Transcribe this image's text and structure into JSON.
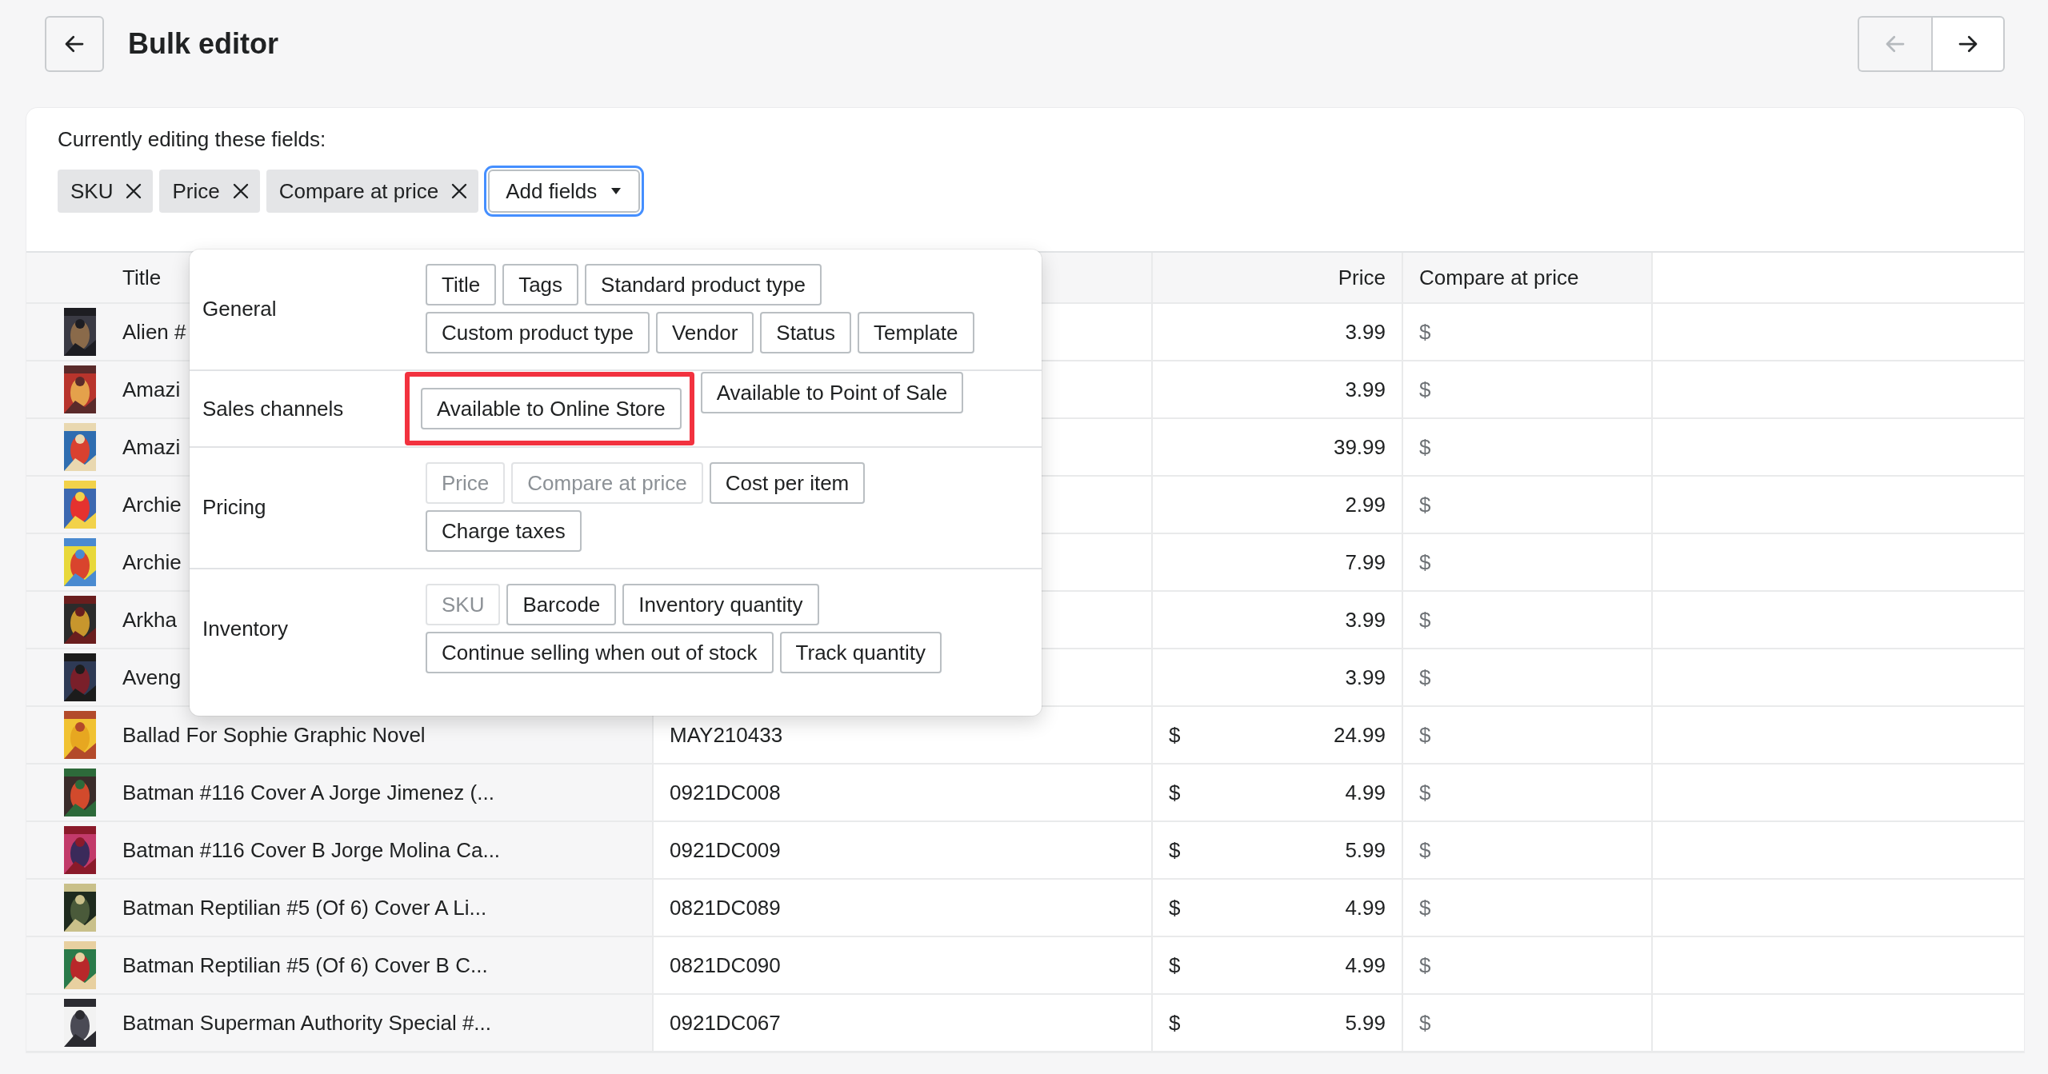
{
  "header": {
    "title": "Bulk editor",
    "nav": [
      {
        "kind": "previous",
        "disabled": true
      },
      {
        "kind": "next",
        "disabled": false
      }
    ]
  },
  "editing": {
    "label": "Currently editing these fields:",
    "fields": [
      "SKU",
      "Price",
      "Compare at price"
    ],
    "add_button": {
      "label": "Add fields",
      "focused": true
    }
  },
  "field_menu": {
    "groups": [
      {
        "name": "General",
        "options": [
          {
            "label": "Title",
            "disabled": false,
            "highlighted": false
          },
          {
            "label": "Tags",
            "disabled": false,
            "highlighted": false
          },
          {
            "label": "Standard product type",
            "disabled": false,
            "highlighted": false
          },
          {
            "label": "Custom product type",
            "disabled": false,
            "highlighted": false
          },
          {
            "label": "Vendor",
            "disabled": false,
            "highlighted": false
          },
          {
            "label": "Status",
            "disabled": false,
            "highlighted": false
          },
          {
            "label": "Template",
            "disabled": false,
            "highlighted": false
          }
        ]
      },
      {
        "name": "Sales channels",
        "options": [
          {
            "label": "Available to Online Store",
            "disabled": false,
            "highlighted": true
          },
          {
            "label": "Available to Point of Sale",
            "disabled": false,
            "highlighted": false
          }
        ]
      },
      {
        "name": "Pricing",
        "options": [
          {
            "label": "Price",
            "disabled": true,
            "highlighted": false
          },
          {
            "label": "Compare at price",
            "disabled": true,
            "highlighted": false
          },
          {
            "label": "Cost per item",
            "disabled": false,
            "highlighted": false
          },
          {
            "label": "Charge taxes",
            "disabled": false,
            "highlighted": false
          }
        ]
      },
      {
        "name": "Inventory",
        "options": [
          {
            "label": "SKU",
            "disabled": true,
            "highlighted": false
          },
          {
            "label": "Barcode",
            "disabled": false,
            "highlighted": false
          },
          {
            "label": "Inventory quantity",
            "disabled": false,
            "highlighted": false
          },
          {
            "label": "Continue selling when out of stock",
            "disabled": false,
            "highlighted": false
          },
          {
            "label": "Track quantity",
            "disabled": false,
            "highlighted": false
          }
        ]
      }
    ]
  },
  "table": {
    "columns": [
      {
        "kind": "title",
        "label": "Title"
      },
      {
        "kind": "sku"
      },
      {
        "kind": "price",
        "label": "Price"
      },
      {
        "kind": "compare",
        "label": "Compare at price"
      }
    ],
    "rows": [
      {
        "title": "Alien #",
        "price": "3.99",
        "compare_currency": "$"
      },
      {
        "title": "Amazi",
        "price": "3.99",
        "compare_currency": "$"
      },
      {
        "title": "Amazi",
        "price": "39.99",
        "compare_currency": "$"
      },
      {
        "title": "Archie",
        "price": "2.99",
        "compare_currency": "$"
      },
      {
        "title": "Archie",
        "price": "7.99",
        "compare_currency": "$"
      },
      {
        "title": "Arkha",
        "price": "3.99",
        "compare_currency": "$"
      },
      {
        "title": "Aveng",
        "price": "3.99",
        "compare_currency": "$"
      },
      {
        "title": "Ballad For Sophie Graphic Novel",
        "sku": "MAY210433",
        "currency": "$",
        "price": "24.99",
        "compare_currency": "$"
      },
      {
        "title": "Batman #116 Cover A Jorge Jimenez (...",
        "sku": "0921DC008",
        "currency": "$",
        "price": "4.99",
        "compare_currency": "$"
      },
      {
        "title": "Batman #116 Cover B Jorge Molina Ca...",
        "sku": "0921DC009",
        "currency": "$",
        "price": "5.99",
        "compare_currency": "$"
      },
      {
        "title": "Batman Reptilian #5 (Of 6) Cover A Li...",
        "sku": "0821DC089",
        "currency": "$",
        "price": "4.99",
        "compare_currency": "$"
      },
      {
        "title": "Batman Reptilian #5 (Of 6) Cover B C...",
        "sku": "0821DC090",
        "currency": "$",
        "price": "4.99",
        "compare_currency": "$"
      },
      {
        "title": "Batman Superman Authority Special #...",
        "sku": "0921DC067",
        "currency": "$",
        "price": "5.99",
        "compare_currency": "$"
      }
    ]
  }
}
